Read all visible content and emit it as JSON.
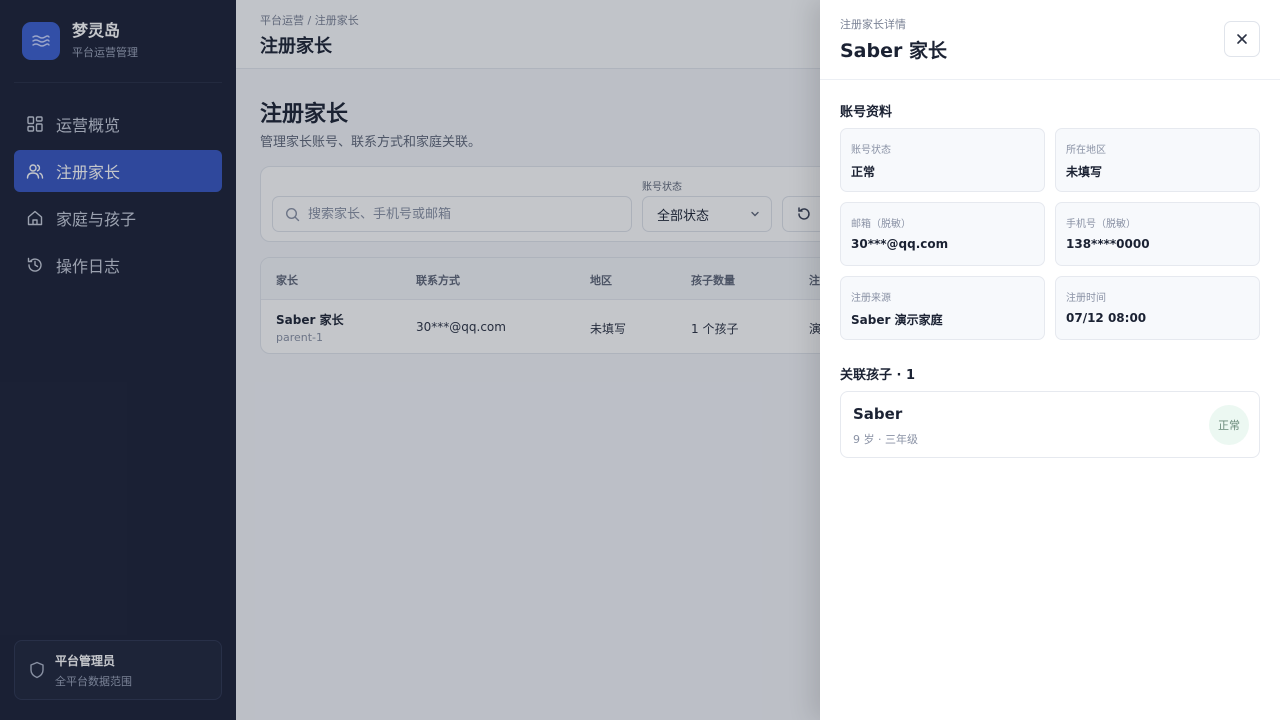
{
  "sidebar": {
    "brand": {
      "title": "梦灵岛",
      "subtitle": "平台运营管理"
    },
    "nav": [
      {
        "label": "运营概览",
        "icon": "grid-icon"
      },
      {
        "label": "注册家长",
        "icon": "users-icon",
        "active": true
      },
      {
        "label": "家庭与孩子",
        "icon": "home-icon"
      },
      {
        "label": "操作日志",
        "icon": "history-icon"
      }
    ],
    "admin": {
      "title": "平台管理员",
      "subtitle": "全平台数据范围"
    }
  },
  "topbar": {
    "breadcrumb": "平台运营 / 注册家长",
    "title": "注册家长"
  },
  "main": {
    "title": "注册家长",
    "subtitle": "管理家长账号、联系方式和家庭关联。",
    "filter": {
      "search_placeholder": "搜索家长、手机号或邮箱",
      "status_label": "账号状态",
      "status_value": "全部状态"
    },
    "table": {
      "headers": [
        "家长",
        "联系方式",
        "地区",
        "孩子数量",
        "注"
      ],
      "rows": [
        {
          "name": "Saber 家长",
          "id": "parent-1",
          "contact": "30***@qq.com",
          "region": "未填写",
          "children": "1 个孩子",
          "source": "演"
        }
      ]
    }
  },
  "drawer": {
    "kicker": "注册家长详情",
    "title": "Saber 家长",
    "account_section": "账号资料",
    "fields": [
      {
        "label": "账号状态",
        "value": "正常"
      },
      {
        "label": "所在地区",
        "value": "未填写"
      },
      {
        "label": "邮箱（脱敏）",
        "value": "30***@qq.com"
      },
      {
        "label": "手机号（脱敏）",
        "value": "138****0000"
      },
      {
        "label": "注册来源",
        "value": "Saber 演示家庭"
      },
      {
        "label": "注册时间",
        "value": "07/12 08:00"
      }
    ],
    "children_section": "关联孩子 · 1",
    "children": [
      {
        "name": "Saber",
        "meta": "9 岁 · 三年级",
        "status": "正常"
      }
    ]
  },
  "colors": {
    "sidebar_bg": "#1a2035",
    "accent": "#3656c2",
    "badge_bg": "#ecf8f2"
  }
}
